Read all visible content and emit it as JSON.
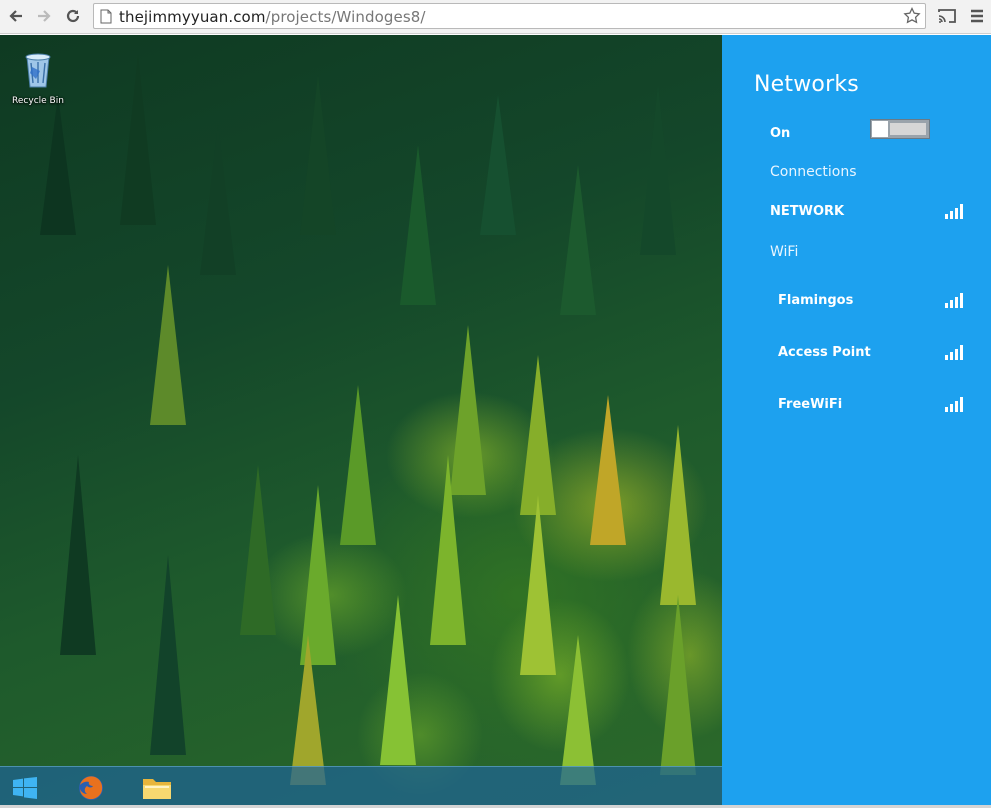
{
  "browser": {
    "url_host": "thejimmyyuan.com",
    "url_path": "/projects/Windoges8/"
  },
  "desktop": {
    "icons": [
      {
        "label": "Recycle Bin",
        "icon": "recycle-bin-icon"
      }
    ],
    "taskbar": [
      {
        "icon": "windows-start-icon"
      },
      {
        "icon": "firefox-icon"
      },
      {
        "icon": "file-explorer-icon"
      }
    ]
  },
  "networks_pane": {
    "title": "Networks",
    "airplane_row_label": "On",
    "connections_heading": "Connections",
    "network_label": "NETWORK",
    "wifi_heading": "WiFi",
    "wifi_networks": [
      {
        "name": "Flamingos"
      },
      {
        "name": "Access Point"
      },
      {
        "name": "FreeWiFi"
      }
    ],
    "accent_color": "#1da1ef"
  }
}
